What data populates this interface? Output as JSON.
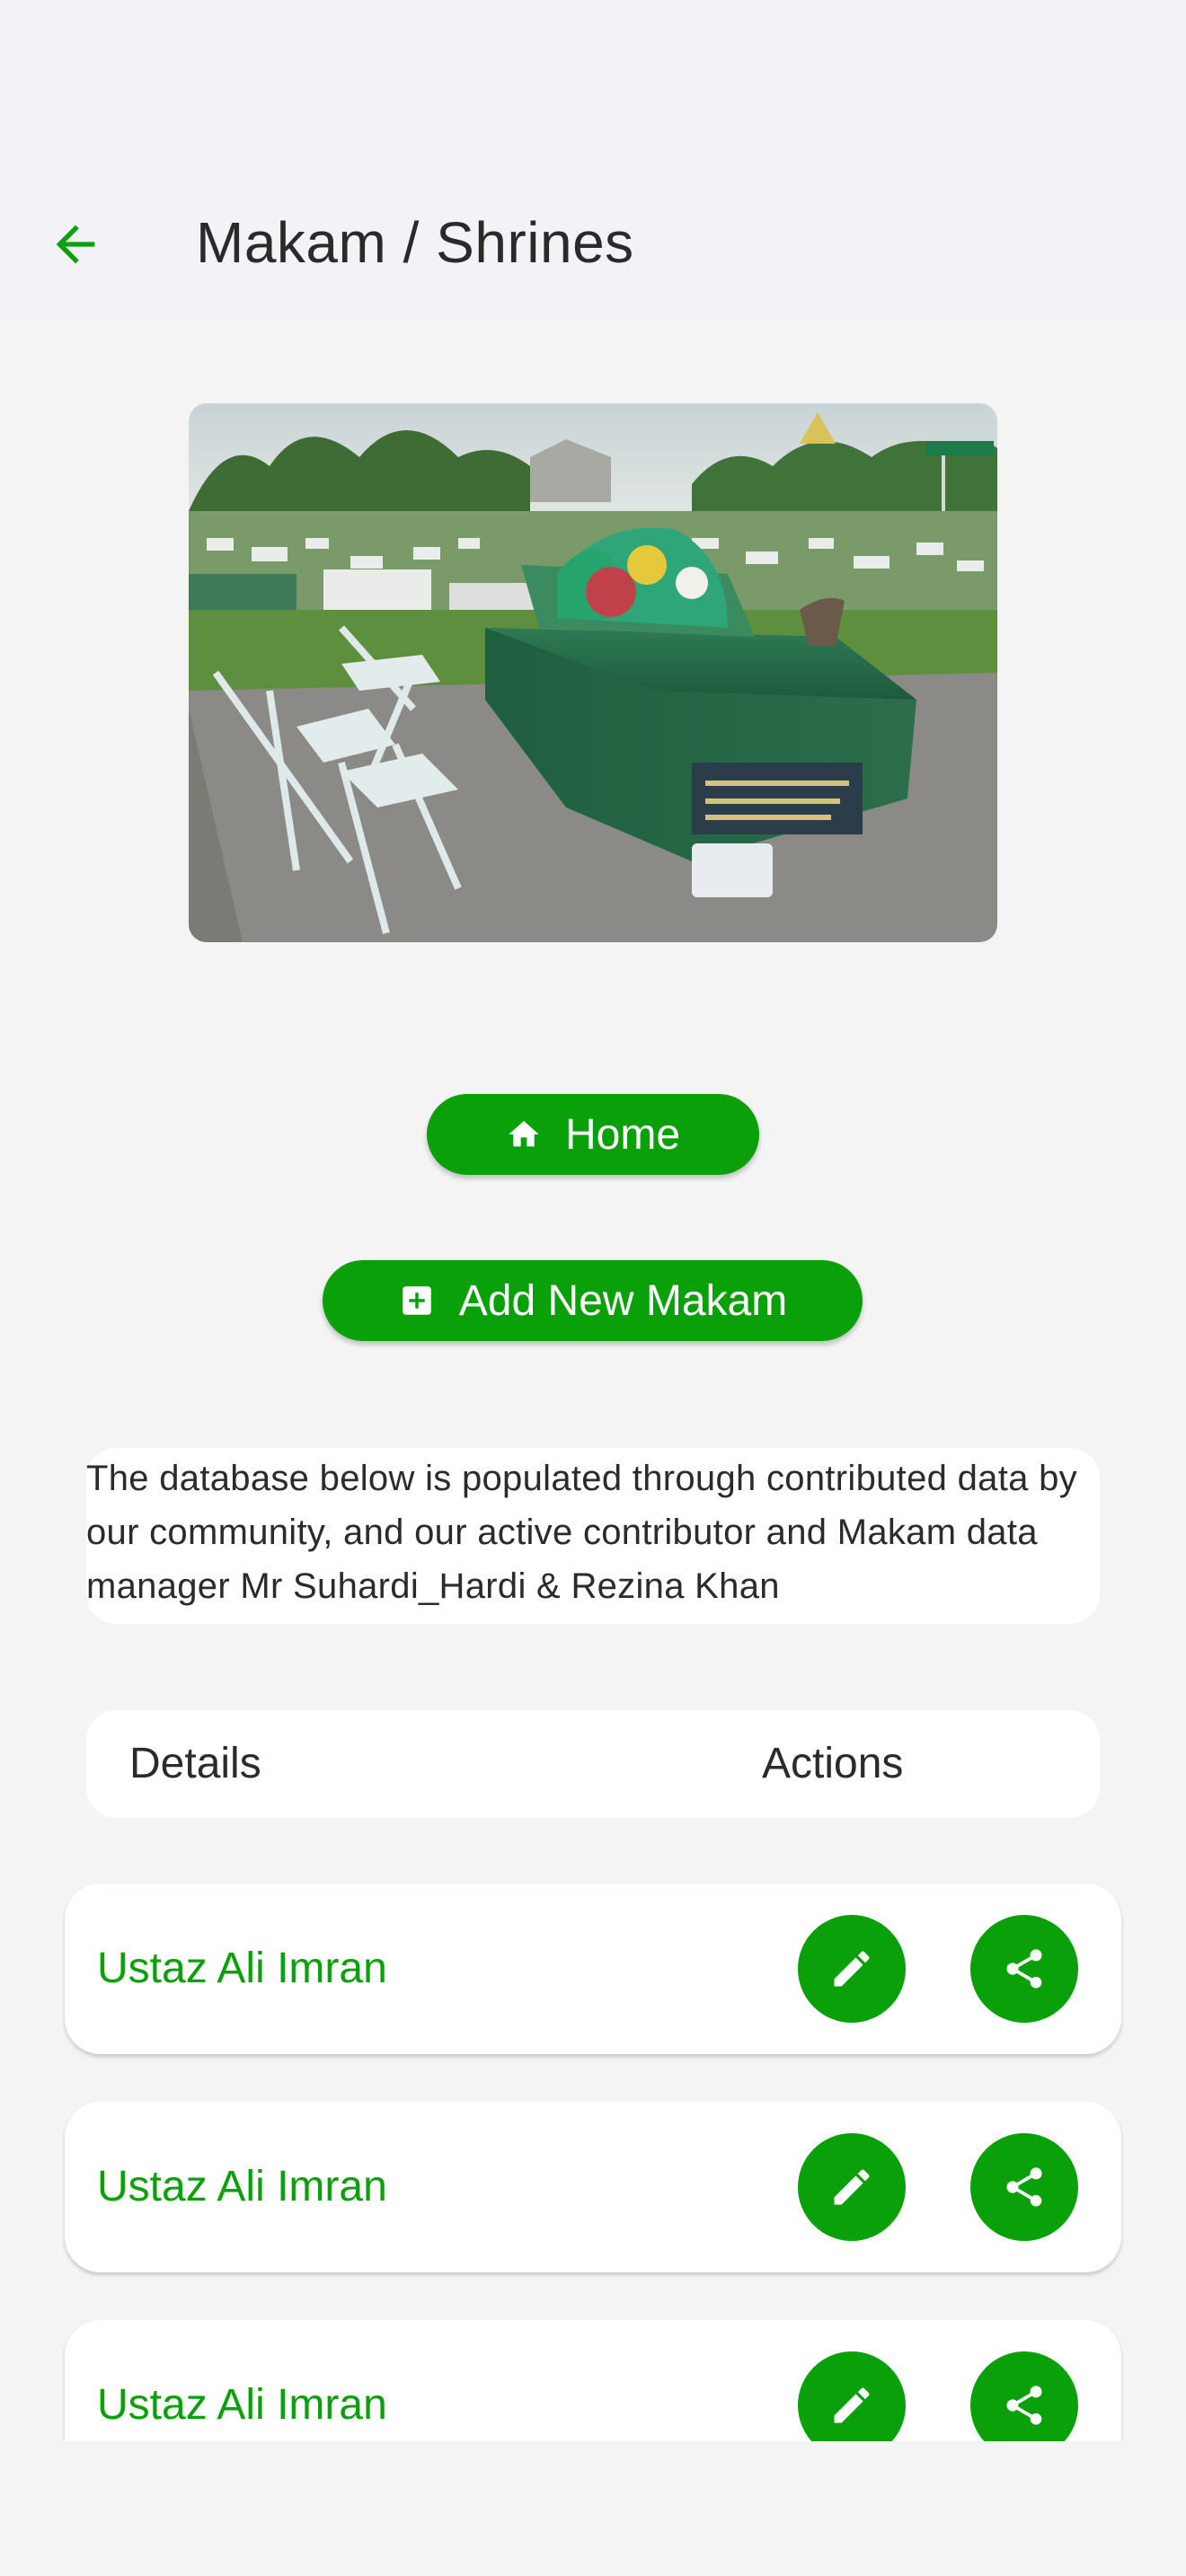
{
  "header": {
    "title": "Makam / Shrines",
    "back_icon": "arrow-left-icon"
  },
  "colors": {
    "accent": "#0aa00a",
    "background": "#f4f4f5",
    "card": "#ffffff",
    "text": "#2b2b2b"
  },
  "hero_image": {
    "alt": "Cemetery photo with a green-tiled shrine tomb and folding chairs"
  },
  "buttons": {
    "home_label": "Home",
    "home_icon": "home-icon",
    "add_label": "Add New Makam",
    "add_icon": "add-box-icon"
  },
  "info": {
    "text": "The database below is populated through contributed data by our community, and our active contributor and Makam data manager Mr Suhardi_Hardi & Rezina Khan"
  },
  "table": {
    "col_details": "Details",
    "col_actions": "Actions"
  },
  "rows": [
    {
      "name": "Ustaz Ali Imran",
      "edit_icon": "pencil-icon",
      "share_icon": "share-icon"
    },
    {
      "name": "Ustaz Ali Imran",
      "edit_icon": "pencil-icon",
      "share_icon": "share-icon"
    },
    {
      "name": "Ustaz Ali Imran",
      "edit_icon": "pencil-icon",
      "share_icon": "share-icon"
    }
  ]
}
